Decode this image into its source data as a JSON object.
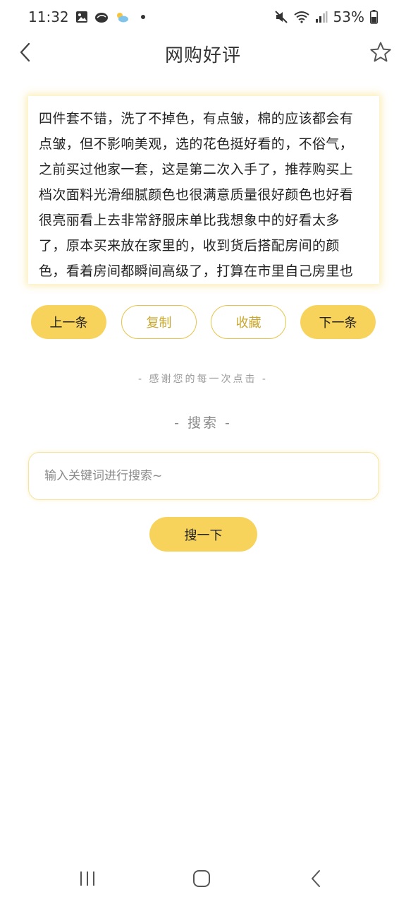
{
  "status_bar": {
    "time": "11:32",
    "battery": "53%",
    "icons": [
      "image-icon",
      "cloud-icon",
      "weather-icon",
      "dot-icon",
      "mute-icon",
      "wifi-icon",
      "signal-icon",
      "battery-icon"
    ]
  },
  "app_bar": {
    "title": "网购好评",
    "back_icon": "back-arrow-icon",
    "star_icon": "star-outline-icon"
  },
  "review": {
    "text": "四件套不错，洗了不掉色，有点皱，棉的应该都会有点皱，但不影响美观，选的花色挺好看的，不俗气，之前买过他家一套，这是第二次入手了，推荐购买上档次面料光滑细腻颜色也很满意质量很好颜色也好看很亮丽看上去非常舒服床单比我想象中的好看太多了，原本买来放在家里的，收到货后搭配房间的颜色，看着房间都瞬间高级了，打算在市里自己房里也"
  },
  "actions": {
    "prev": "上一条",
    "copy": "复制",
    "favorite": "收藏",
    "next": "下一条"
  },
  "thanks_text": "- 感谢您的每一次点击 -",
  "search": {
    "heading": "- 搜索 -",
    "placeholder": "输入关键词进行搜索~",
    "value": "",
    "button": "搜一下"
  },
  "nav_bar": {
    "icons": [
      "recent-apps-icon",
      "home-icon",
      "back-icon"
    ]
  },
  "colors": {
    "accent": "#f8d35c",
    "outline": "#e6c44a",
    "outline_text": "#c9a72c"
  }
}
